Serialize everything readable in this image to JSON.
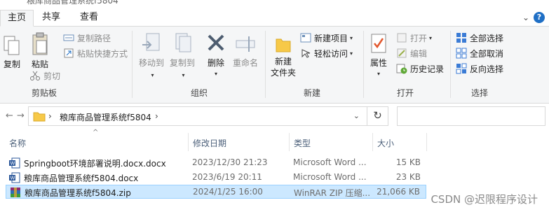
{
  "window": {
    "title": "粮库商品管理系统f5804"
  },
  "ribbon": {
    "tabs": [
      {
        "label": "主页"
      },
      {
        "label": "共享"
      },
      {
        "label": "查看"
      }
    ],
    "clipboard": {
      "label": "剪贴板",
      "copy": "复制",
      "paste": "粘贴",
      "copy_path": "复制路径",
      "paste_shortcut": "粘贴快捷方式",
      "cut": "剪切"
    },
    "organize": {
      "label": "组织",
      "move_to": "移动到",
      "copy_to": "复制到",
      "delete": "删除",
      "rename": "重命名"
    },
    "new": {
      "label": "新建",
      "new_folder_line1": "新建",
      "new_folder_line2": "文件夹",
      "new_item": "新建项目",
      "easy_access": "轻松访问"
    },
    "open": {
      "label": "打开",
      "properties": "属性",
      "open": "打开",
      "edit": "编辑",
      "history": "历史记录"
    },
    "select": {
      "label": "选择",
      "select_all": "全部选择",
      "select_none": "全部取消",
      "invert": "反向选择"
    }
  },
  "address": {
    "path": "粮库商品管理系统f5804",
    "search_placeholder": ""
  },
  "file_list": {
    "columns": {
      "name": "名称",
      "date": "修改日期",
      "type": "类型",
      "size": "大小"
    },
    "rows": [
      {
        "name": "Springboot环境部署说明.docx.docx",
        "date": "2023/12/30 21:23",
        "type": "Microsoft Word ...",
        "size": "15 KB",
        "icon": "word-doc-icon"
      },
      {
        "name": "粮库商品管理系统f5804.docx",
        "date": "2023/6/19 20:11",
        "type": "Microsoft Word ...",
        "size": "23 KB",
        "icon": "word-doc-icon"
      },
      {
        "name": "粮库商品管理系统f5804.zip",
        "date": "2024/1/25 16:00",
        "type": "WinRAR ZIP 压缩...",
        "size": "21,066 KB",
        "icon": "winrar-archive-icon"
      }
    ]
  },
  "watermark": "CSDN @迟限程序设计",
  "colors": {
    "accent": "#1f6fc5",
    "selection": "#cce8ff",
    "selection_border": "#99d1ff",
    "folder": "#f7c948"
  }
}
